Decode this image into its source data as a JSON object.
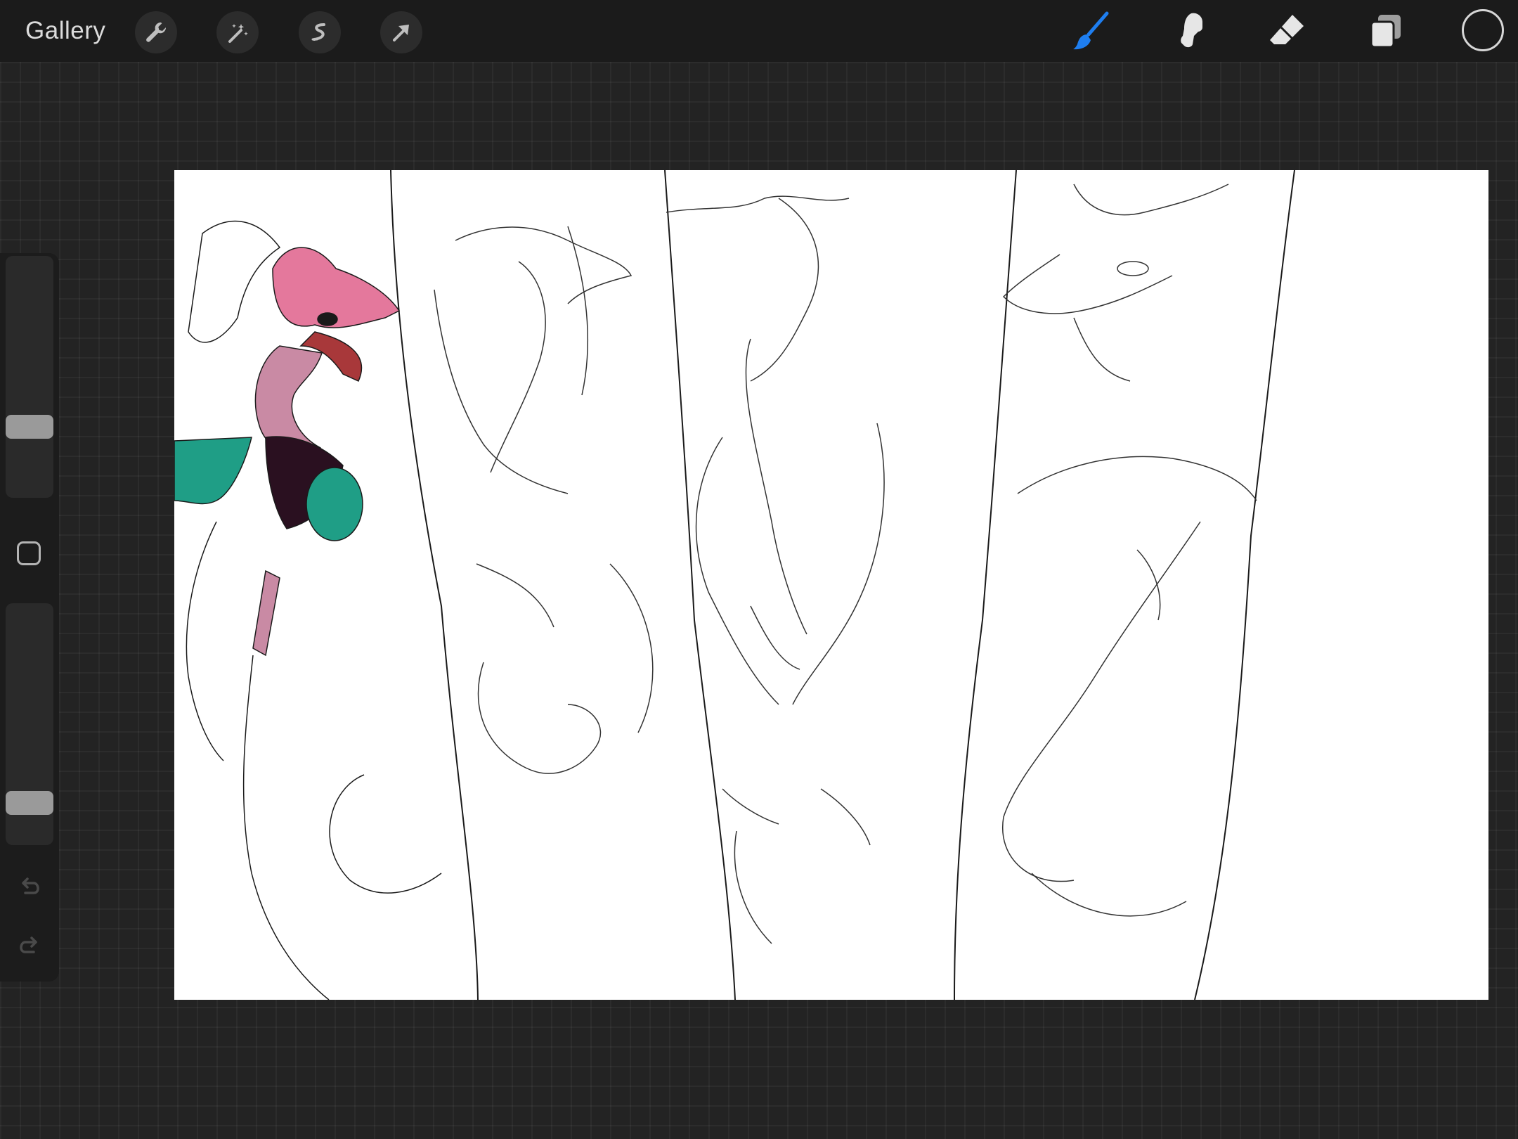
{
  "topbar": {
    "gallery_label": "Gallery",
    "left_tools": [
      "wrench-icon",
      "magic-wand-icon",
      "selection-icon",
      "transform-arrow-icon"
    ],
    "right_tools": [
      "brush-icon",
      "smudge-icon",
      "eraser-icon",
      "layers-icon"
    ],
    "active_tool": "brush",
    "colors": {
      "active_tool": "#1e7ef0",
      "inactive_tool": "#e6e6e6",
      "current_color": "#1b1b1b"
    }
  },
  "sidebar": {
    "brush_size": 0.27,
    "opacity": 0.14,
    "icons": [
      "modifier-square-icon",
      "undo-icon",
      "redo-icon"
    ]
  },
  "canvas": {
    "colors": {
      "paper": "#ffffff",
      "line": "#1a1a1a",
      "head": "#e4789c",
      "horn": "#c98aa4",
      "wing": "#1f9e86",
      "belly": "#2a1020",
      "mouth": "#a8383a"
    }
  }
}
